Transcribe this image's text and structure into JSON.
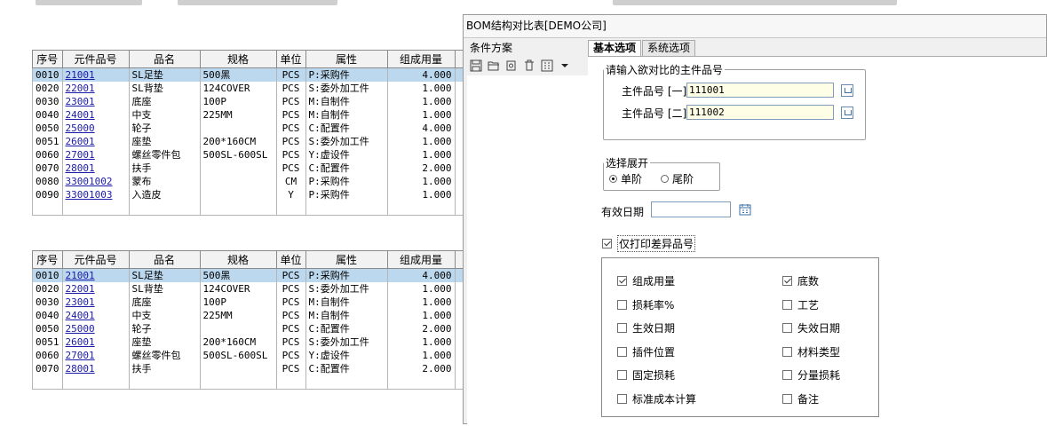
{
  "table1": {
    "headers": [
      "序号",
      "元件品号",
      "品名",
      "规格",
      "单位",
      "属性",
      "组成用量"
    ],
    "rows": [
      [
        "0010",
        "21001",
        "SL足垫",
        "500黑",
        "PCS",
        "P:采购件",
        "4.000"
      ],
      [
        "0020",
        "22001",
        "SL背垫",
        "124COVER",
        "PCS",
        "S:委外加工件",
        "1.000"
      ],
      [
        "0030",
        "23001",
        "底座",
        "100P",
        "PCS",
        "M:自制件",
        "1.000"
      ],
      [
        "0040",
        "24001",
        "中支",
        "225MM",
        "PCS",
        "M:自制件",
        "1.000"
      ],
      [
        "0050",
        "25000",
        "轮子",
        "",
        "PCS",
        "C:配置件",
        "4.000"
      ],
      [
        "0051",
        "26001",
        "座垫",
        "200*160CM",
        "PCS",
        "S:委外加工件",
        "1.000"
      ],
      [
        "0060",
        "27001",
        "螺丝零件包",
        "500SL-600SL",
        "PCS",
        "Y:虚设件",
        "1.000"
      ],
      [
        "0070",
        "28001",
        "扶手",
        "",
        "PCS",
        "C:配置件",
        "2.000"
      ],
      [
        "0080",
        "33001002",
        "蒙布",
        "",
        "CM",
        "P:采购件",
        "1.000"
      ],
      [
        "0090",
        "33001003",
        "入造皮",
        "",
        "Y",
        "P:采购件",
        "1.000"
      ]
    ]
  },
  "table2": {
    "headers": [
      "序号",
      "元件品号",
      "品名",
      "规格",
      "单位",
      "属性",
      "组成用量"
    ],
    "rows": [
      [
        "0010",
        "21001",
        "SL足垫",
        "500黑",
        "PCS",
        "P:采购件",
        "4.000"
      ],
      [
        "0020",
        "22001",
        "SL背垫",
        "124COVER",
        "PCS",
        "S:委外加工件",
        "1.000"
      ],
      [
        "0030",
        "23001",
        "底座",
        "100P",
        "PCS",
        "M:自制件",
        "1.000"
      ],
      [
        "0040",
        "24001",
        "中支",
        "225MM",
        "PCS",
        "M:自制件",
        "1.000"
      ],
      [
        "0050",
        "25000",
        "轮子",
        "",
        "PCS",
        "C:配置件",
        "2.000"
      ],
      [
        "0051",
        "26001",
        "座垫",
        "200*160CM",
        "PCS",
        "S:委外加工件",
        "1.000"
      ],
      [
        "0060",
        "27001",
        "螺丝零件包",
        "500SL-600SL",
        "PCS",
        "Y:虚设件",
        "1.000"
      ],
      [
        "0070",
        "28001",
        "扶手",
        "",
        "PCS",
        "C:配置件",
        "2.000"
      ]
    ]
  },
  "dialog": {
    "title": "BOM结构对比表[DEMO公司]",
    "left_pane_title": "条件方案",
    "toolbar_icons": [
      "save-icon",
      "open-folder-icon",
      "copy-icon",
      "delete-icon",
      "layout-icon",
      "dropdown-arrow-icon"
    ],
    "tabs": [
      "基本选项",
      "系统选项"
    ],
    "group_main_item": {
      "legend": "请输入欲对比的主件品号",
      "label1": "主件品号 [一]",
      "value1": "111001",
      "label2": "主件品号 [二]",
      "value2": "111002"
    },
    "group_expand": {
      "legend": "选择展开",
      "option1": "单阶",
      "option2": "尾阶",
      "selected": "单阶"
    },
    "effective_date_label": "有效日期",
    "effective_date_value": "",
    "print_diff_label": "仅打印差异品号",
    "print_diff_checked": true,
    "options": [
      {
        "label": "组成用量",
        "checked": true
      },
      {
        "label": "底数",
        "checked": true
      },
      {
        "label": "损耗率%",
        "checked": false
      },
      {
        "label": "工艺",
        "checked": false
      },
      {
        "label": "生效日期",
        "checked": false
      },
      {
        "label": "失效日期",
        "checked": false
      },
      {
        "label": "插件位置",
        "checked": false
      },
      {
        "label": "材料类型",
        "checked": false
      },
      {
        "label": "固定损耗",
        "checked": false
      },
      {
        "label": "分量损耗",
        "checked": false
      },
      {
        "label": "标准成本计算",
        "checked": false
      },
      {
        "label": "备注",
        "checked": false
      }
    ]
  },
  "colors": {
    "selected_row": "#bcd8ee",
    "link": "#1a1aa8",
    "input_bg": "#fefde6",
    "dialog_bg": "#f0f0f0"
  }
}
